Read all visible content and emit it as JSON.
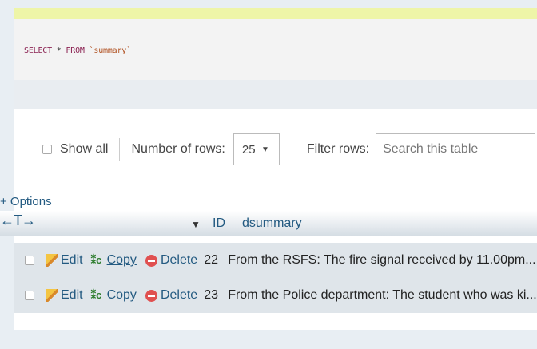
{
  "query": {
    "select_kw": "SELECT",
    "star": "*",
    "from_kw": "FROM",
    "table": "`summary`"
  },
  "navigation": {
    "show_all_label": "Show all",
    "number_of_rows_label": "Number of rows:",
    "rows_selected": "25",
    "filter_label": "Filter rows:",
    "filter_placeholder": "Search this table"
  },
  "options_label": "+ Options",
  "columns_arrows": "←T→",
  "table": {
    "headers": {
      "id": "ID",
      "dsummary": "dsummary"
    },
    "actions": {
      "edit": "Edit",
      "copy": "Copy",
      "delete": "Delete"
    },
    "rows": [
      {
        "id": "22",
        "dsummary": "From the RSFS: The fire signal received by 11.00pm..."
      },
      {
        "id": "23",
        "dsummary": "From the Police department: The student who was ki..."
      }
    ]
  },
  "colors": {
    "link": "#235a81",
    "row_bg": "#dfe5ea",
    "sql_highlight": "#eef5a8",
    "delete": "#e05050"
  }
}
